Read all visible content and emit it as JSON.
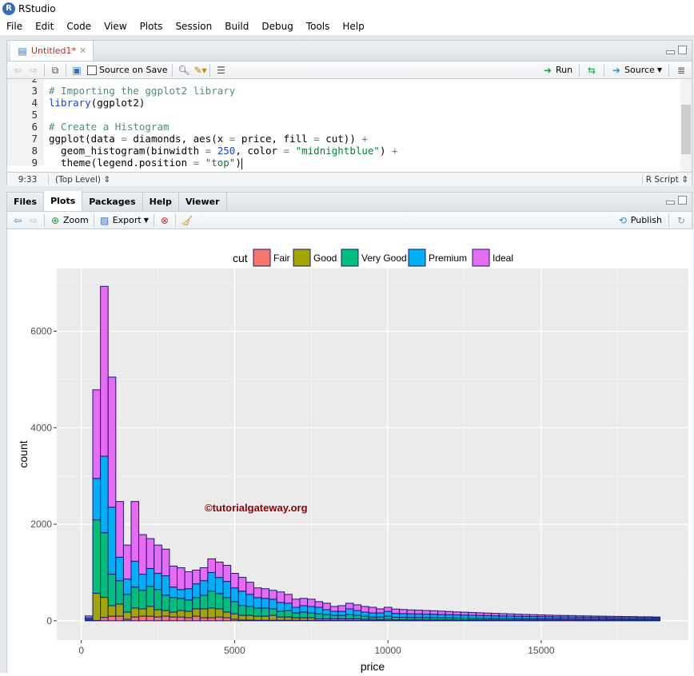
{
  "app": {
    "title": "RStudio"
  },
  "menu": [
    "File",
    "Edit",
    "Code",
    "View",
    "Plots",
    "Session",
    "Build",
    "Debug",
    "Tools",
    "Help"
  ],
  "editor": {
    "tab_label": "Untitled1*",
    "source_on_save": "Source on Save",
    "run_label": "Run",
    "source_label": "Source",
    "line_numbers": [
      "2",
      "3",
      "4",
      "5",
      "6",
      "7",
      "8",
      "9"
    ],
    "lines": [
      [
        {
          "t": "",
          "c": "pl"
        }
      ],
      [
        {
          "t": "# Importing the ggplot2 library",
          "c": "cm"
        }
      ],
      [
        {
          "t": "library",
          "c": "kw"
        },
        {
          "t": "(ggplot2)",
          "c": "pl"
        }
      ],
      [
        {
          "t": "",
          "c": "pl"
        }
      ],
      [
        {
          "t": "# Create a Histogram",
          "c": "cm"
        }
      ],
      [
        {
          "t": "ggplot(data ",
          "c": "pl"
        },
        {
          "t": "=",
          "c": "op"
        },
        {
          "t": " diamonds, aes(x ",
          "c": "pl"
        },
        {
          "t": "=",
          "c": "op"
        },
        {
          "t": " price, fill ",
          "c": "pl"
        },
        {
          "t": "=",
          "c": "op"
        },
        {
          "t": " cut)) ",
          "c": "pl"
        },
        {
          "t": "+",
          "c": "op"
        }
      ],
      [
        {
          "t": "  geom_histogram(binwidth ",
          "c": "pl"
        },
        {
          "t": "=",
          "c": "op"
        },
        {
          "t": " ",
          "c": "pl"
        },
        {
          "t": "250",
          "c": "num"
        },
        {
          "t": ", color ",
          "c": "pl"
        },
        {
          "t": "=",
          "c": "op"
        },
        {
          "t": " ",
          "c": "pl"
        },
        {
          "t": "\"midnightblue\"",
          "c": "str"
        },
        {
          "t": ") ",
          "c": "pl"
        },
        {
          "t": "+",
          "c": "op"
        }
      ],
      [
        {
          "t": "  theme(legend.position ",
          "c": "pl"
        },
        {
          "t": "=",
          "c": "op"
        },
        {
          "t": " ",
          "c": "pl"
        },
        {
          "t": "\"top\"",
          "c": "str"
        },
        {
          "t": ")",
          "c": "pl"
        }
      ]
    ],
    "cursor_pos": "9:33",
    "scope": "(Top Level)",
    "file_type": "R Script"
  },
  "plots_pane": {
    "tabs": [
      "Files",
      "Plots",
      "Packages",
      "Help",
      "Viewer"
    ],
    "active_tab": "Plots",
    "zoom_label": "Zoom",
    "export_label": "Export",
    "publish_label": "Publish"
  },
  "watermark": "©tutorialgateway.org",
  "chart_data": {
    "type": "bar",
    "stacked": true,
    "binwidth": 250,
    "xlabel": "price",
    "ylabel": "count",
    "xlim": [
      -800,
      19800
    ],
    "ylim": [
      -400,
      7300
    ],
    "xticks": [
      0,
      5000,
      10000,
      15000
    ],
    "xtick_labels": [
      "0",
      "5000",
      "10000",
      "15000"
    ],
    "yticks": [
      0,
      2000,
      4000,
      6000
    ],
    "ytick_labels": [
      "0",
      "2000",
      "4000",
      "6000"
    ],
    "grid": true,
    "legend": {
      "title": "cut",
      "position": "top"
    },
    "bar_outline": "#191970",
    "x_start": 250,
    "series": [
      {
        "name": "Fair",
        "color": "#F8766D",
        "values": [
          0,
          5,
          70,
          95,
          95,
          30,
          78,
          95,
          95,
          78,
          95,
          78,
          78,
          62,
          95,
          62,
          62,
          78,
          62,
          30,
          14,
          14,
          10,
          10,
          10,
          10,
          10,
          8,
          8,
          8,
          8,
          8,
          8,
          8,
          8,
          8,
          6,
          6,
          6,
          6,
          4,
          4,
          4,
          4,
          4,
          4,
          4,
          4,
          4,
          4,
          4,
          4,
          4,
          4,
          4,
          4,
          4,
          4,
          4,
          4,
          4,
          4,
          4,
          4,
          4,
          4,
          4,
          4,
          4,
          4,
          4,
          4,
          4,
          4,
          4
        ]
      },
      {
        "name": "Good",
        "color": "#A3A500",
        "values": [
          10,
          565,
          415,
          217,
          251,
          149,
          185,
          151,
          201,
          151,
          117,
          101,
          134,
          133,
          151,
          184,
          201,
          168,
          117,
          115,
          98,
          98,
          85,
          85,
          102,
          68,
          68,
          54,
          54,
          54,
          32,
          32,
          32,
          32,
          32,
          32,
          24,
          24,
          19,
          24,
          18,
          18,
          17,
          17,
          16,
          16,
          15,
          15,
          14,
          14,
          13,
          13,
          13,
          12,
          12,
          12,
          11,
          11,
          11,
          10,
          10,
          10,
          10,
          10,
          9,
          9,
          9,
          9,
          9,
          8,
          8,
          8,
          8,
          8,
          8
        ]
      },
      {
        "name": "Very Good",
        "color": "#00BF7D",
        "values": [
          20,
          1520,
          1340,
          653,
          485,
          368,
          435,
          385,
          418,
          418,
          318,
          301,
          251,
          235,
          234,
          284,
          351,
          318,
          301,
          251,
          201,
          184,
          168,
          168,
          134,
          117,
          134,
          100,
          117,
          100,
          105,
          88,
          72,
          72,
          88,
          72,
          65,
          48,
          53,
          65,
          50,
          48,
          47,
          46,
          45,
          44,
          42,
          40,
          39,
          38,
          36,
          35,
          34,
          33,
          32,
          31,
          30,
          29,
          28,
          28,
          27,
          26,
          25,
          25,
          24,
          24,
          23,
          23,
          22,
          22,
          21,
          21,
          20,
          20,
          20
        ]
      },
      {
        "name": "Premium",
        "color": "#00B0F6",
        "values": [
          30,
          860,
          1585,
          1389,
          486,
          318,
          535,
          334,
          369,
          335,
          402,
          218,
          185,
          234,
          285,
          301,
          385,
          334,
          335,
          285,
          301,
          251,
          217,
          200,
          201,
          185,
          151,
          117,
          134,
          134,
          134,
          101,
          83,
          83,
          118,
          100,
          84,
          84,
          84,
          100,
          80,
          78,
          76,
          74,
          72,
          70,
          68,
          66,
          64,
          62,
          60,
          58,
          56,
          54,
          52,
          50,
          48,
          46,
          45,
          44,
          42,
          40,
          40,
          38,
          37,
          36,
          35,
          34,
          33,
          32,
          32,
          31,
          30,
          30,
          28
        ]
      },
      {
        "name": "Ideal",
        "color": "#E76BF3",
        "values": [
          40,
          1836,
          3520,
          2695,
          1154,
          703,
          1238,
          820,
          619,
          586,
          552,
          435,
          451,
          352,
          284,
          268,
          284,
          318,
          334,
          302,
          285,
          251,
          201,
          201,
          184,
          217,
          184,
          168,
          150,
          151,
          117,
          134,
          101,
          118,
          117,
          118,
          117,
          117,
          84,
          84,
          90,
          85,
          80,
          78,
          75,
          72,
          70,
          66,
          62,
          60,
          58,
          55,
          52,
          50,
          48,
          45,
          42,
          40,
          38,
          36,
          34,
          32,
          30,
          30,
          28,
          28,
          26,
          25,
          24,
          24,
          22,
          22,
          20,
          20,
          18
        ]
      }
    ]
  }
}
